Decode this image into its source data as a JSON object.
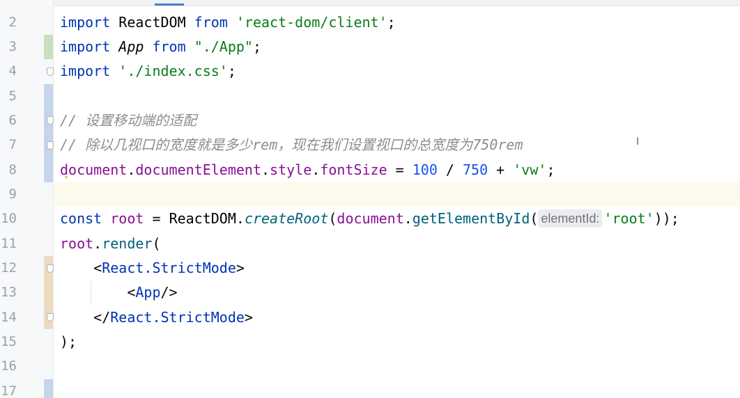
{
  "editor": {
    "line_numbers": [
      "2",
      "3",
      "4",
      "5",
      "6",
      "7",
      "8",
      "9",
      "10",
      "11",
      "12",
      "13",
      "14",
      "15",
      "16",
      "17"
    ],
    "lines": {
      "l2": [
        "import",
        "ReactDOM",
        "from",
        "'react-dom/client'",
        ";"
      ],
      "l3": [
        "import",
        "App",
        "from",
        "\"./App\"",
        ";"
      ],
      "l4": [
        "import",
        "'./index.css'",
        ";"
      ],
      "l6": [
        "//",
        "设置移动端的适配"
      ],
      "l7": [
        "//",
        "除以几视口的宽度就是多少",
        "rem",
        "，现在我们设置视口的总宽度为",
        "750rem"
      ],
      "l8": [
        "document",
        ".",
        "documentElement",
        ".",
        "style",
        ".",
        "fontSize",
        " = ",
        "100",
        " / ",
        "750",
        " + ",
        "'vw'",
        ";"
      ],
      "l10": [
        "const",
        "root",
        " = ",
        "ReactDOM",
        ".",
        "createRoot",
        "(",
        "document",
        ".",
        "getElementById",
        "(",
        "elementId:",
        "'root'",
        "));"
      ],
      "l11": [
        "root",
        ".",
        "render",
        "("
      ],
      "l12": [
        "<",
        "React.StrictMode",
        ">"
      ],
      "l13": [
        "<",
        "App",
        "/>"
      ],
      "l14": [
        "</",
        "React.StrictMode",
        ">"
      ],
      "l15": [
        ");"
      ]
    }
  },
  "colors": {
    "keyword": "#0033b3",
    "string": "#067d17",
    "number": "#1750eb",
    "property": "#871094",
    "function": "#00627a",
    "comment": "#8c8c8c"
  }
}
